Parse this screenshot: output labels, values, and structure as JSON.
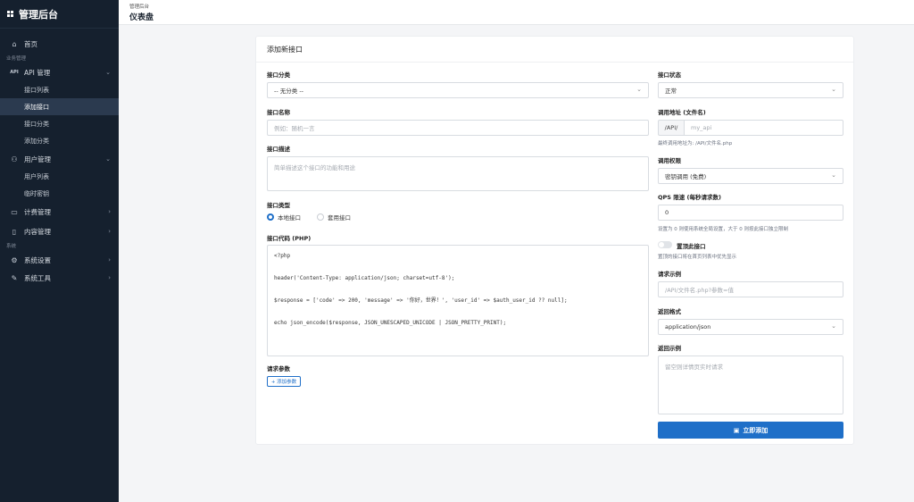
{
  "brand": {
    "title": "管理后台"
  },
  "header": {
    "breadcrumb": "管理后台",
    "title": "仪表盘"
  },
  "sidebar": {
    "home": "首页",
    "section_business": "业务管理",
    "api_group": "API 管理",
    "api_items": [
      "接口列表",
      "添加接口",
      "接口分类",
      "添加分类"
    ],
    "user_group": "用户管理",
    "user_items": [
      "用户列表",
      "临时密钥"
    ],
    "billing": "计费管理",
    "content": "内容管理",
    "section_system": "系统",
    "settings": "系统设置",
    "tools": "系统工具"
  },
  "form": {
    "card_title": "添加新接口",
    "category_label": "接口分类",
    "category_value": "-- 无分类 --",
    "name_label": "接口名称",
    "name_placeholder": "例如：随机一言",
    "desc_label": "接口描述",
    "desc_placeholder": "简单描述这个接口的功能和用途",
    "type_label": "接口类型",
    "type_options": [
      "本地接口",
      "套用接口"
    ],
    "code_label": "接口代码 (PHP)",
    "code_lines": [
      "<?php",
      "",
      "header('Content-Type: application/json; charset=utf-8');",
      "",
      "$response = ['code' => 200, 'message' => '你好，世界！', 'user_id' => $auth_user_id ?? null];",
      "",
      "echo json_encode($response, JSON_UNESCAPED_UNICODE | JSON_PRETTY_PRINT);"
    ],
    "params_label": "请求参数",
    "add_param": "+ 添加参数",
    "status_label": "接口状态",
    "status_value": "正常",
    "url_label": "调用地址 (文件名)",
    "url_prefix": "/API/",
    "url_placeholder": "my_api",
    "url_hint": "最终调用地址为: /API/文件名.php",
    "perm_label": "调用权限",
    "perm_value": "密钥调用 (免费)",
    "qps_label": "QPS 限速 (每秒请求数)",
    "qps_value": "0",
    "qps_hint": "设置为 0 则使用系统全局设置，大于 0 则按此接口独立限制",
    "pin_label": "置顶此接口",
    "pin_hint": "置顶的接口将在首页列表中优先显示",
    "req_example_label": "请求示例",
    "req_example_placeholder": "/API/文件名.php?参数=值",
    "return_format_label": "返回格式",
    "return_format_value": "application/json",
    "return_example_label": "返回示例",
    "return_example_placeholder": "留空则详情页实时请求",
    "submit": "立即添加"
  }
}
